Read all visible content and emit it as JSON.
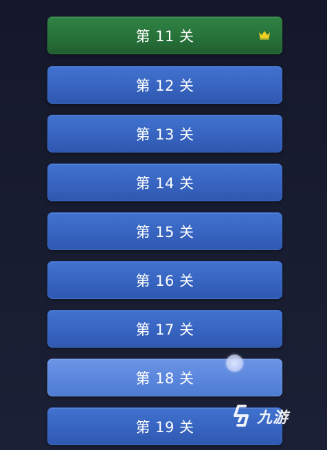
{
  "levels": [
    {
      "label": "第 11 关",
      "state": "completed",
      "badge": "crown-icon"
    },
    {
      "label": "第 12 关",
      "state": "unlocked"
    },
    {
      "label": "第 13 关",
      "state": "unlocked"
    },
    {
      "label": "第 14 关",
      "state": "unlocked"
    },
    {
      "label": "第 15 关",
      "state": "unlocked"
    },
    {
      "label": "第 16 关",
      "state": "unlocked"
    },
    {
      "label": "第 17 关",
      "state": "unlocked"
    },
    {
      "label": "第 18 关",
      "state": "active"
    },
    {
      "label": "第 19 关",
      "state": "unlocked"
    }
  ],
  "watermark": {
    "text": "九游",
    "icon": "jiuyou-logo-icon"
  },
  "colors": {
    "background": "#181c30",
    "level_button": "#3764c0",
    "level_completed": "#277239",
    "level_active": "#5a86dc",
    "crown": "#f2d024"
  }
}
